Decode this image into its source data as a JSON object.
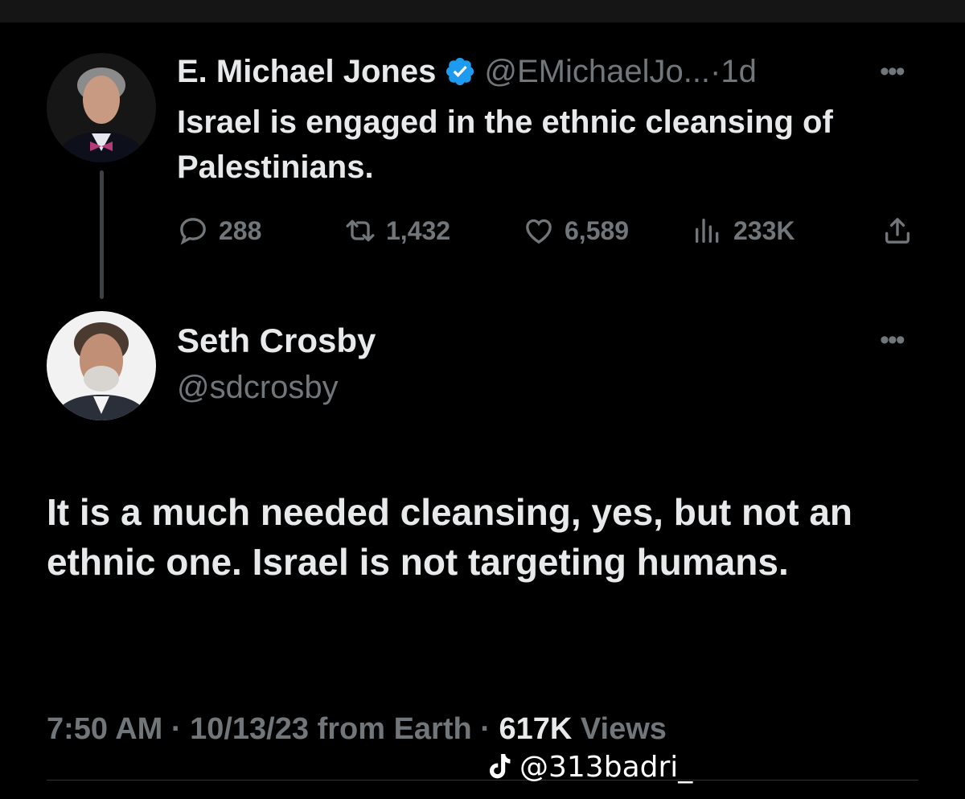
{
  "original_tweet": {
    "author_name": "E. Michael Jones",
    "handle": "@EMichaelJo...",
    "separator": " · ",
    "time_ago": "1d",
    "more_icon": "more-horizontal-icon",
    "text": "Israel is engaged in the ethnic cleansing of Palestinians.",
    "stats": {
      "replies": "288",
      "retweets": "1,432",
      "likes": "6,589",
      "views": "233K"
    },
    "verified_color": "#1d9bf0"
  },
  "reply_tweet": {
    "author_name": "Seth Crosby",
    "handle": "@sdcrosby",
    "more_icon": "more-horizontal-icon",
    "text": "It is a much needed cleansing, yes, but not an ethnic one. Israel is not targeting humans.",
    "time": "7:50 AM",
    "dot": " · ",
    "date": "10/13/23",
    "source": " from Earth",
    "views_count": "617K",
    "views_label": " Views"
  },
  "watermark": {
    "icon": "tiktok-icon",
    "text": "@313badri_"
  },
  "colors": {
    "background": "#000000",
    "primary_text": "#e7e9ea",
    "secondary_text": "#71767b",
    "accent": "#1d9bf0"
  }
}
